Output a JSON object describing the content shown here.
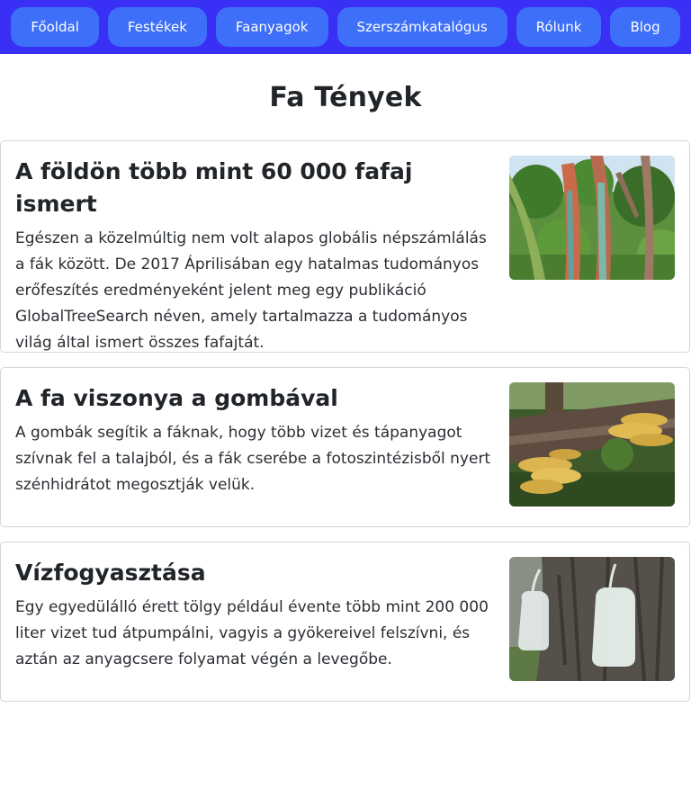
{
  "nav": {
    "items": [
      {
        "label": "Főoldal"
      },
      {
        "label": "Festékek"
      },
      {
        "label": "Faanyagok"
      },
      {
        "label": "Szerszámkatalógus"
      },
      {
        "label": "Rólunk"
      },
      {
        "label": "Blog"
      }
    ]
  },
  "page": {
    "title": "Fa Tények"
  },
  "cards": [
    {
      "title": "A földön több mint 60 000 fafaj ismert",
      "text": "Egészen a közelmúltig nem volt alapos globális népszámlálás a fák között. De 2017 Áprilisában egy hatalmas tudományos erőfeszítés eredményeként jelent meg egy publikáció GlobalTreeSearch néven, amely tartalmazza a tudományos világ által ismert összes fafajtát.",
      "image_icon": "rainbow-eucalyptus-photo"
    },
    {
      "title": "A fa viszonya a gombával",
      "text": "A gombák segítik a fáknak, hogy több vizet és tápanyagot szívnak fel a talajból, és a fák cserébe a fotoszintézisből nyert szénhidrátot megosztják velük.",
      "image_icon": "bracket-fungus-photo"
    },
    {
      "title": "Vízfogyasztása",
      "text": "Egy egyedülálló érett tölgy például évente több mint 200 000 liter vizet tud átpumpálni, vagyis a gyökereivel felszívni, és aztán az anyagcsere folyamat végén a levegőbe.",
      "image_icon": "sap-jugs-on-tree-photo"
    }
  ],
  "colors": {
    "navbar_bg": "#3a2ff5",
    "nav_button_bg": "#3d6ff8",
    "nav_button_text": "#ffffff",
    "card_border": "#d6d6d6"
  }
}
